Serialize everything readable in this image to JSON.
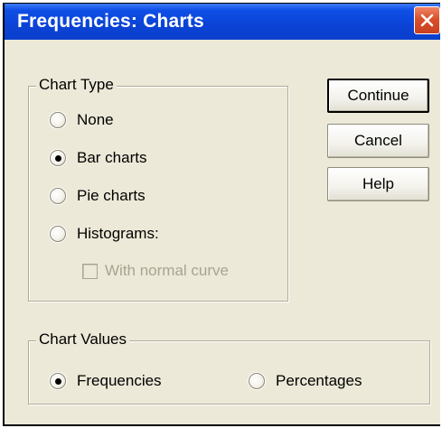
{
  "window": {
    "title": "Frequencies: Charts"
  },
  "chart_type": {
    "group_label": "Chart Type",
    "options": [
      {
        "label": "None",
        "selected": false
      },
      {
        "label": "Bar charts",
        "selected": true
      },
      {
        "label": "Pie charts",
        "selected": false
      },
      {
        "label": "Histograms:",
        "selected": false
      }
    ],
    "normal_curve": {
      "label": "With normal curve",
      "checked": false,
      "enabled": false
    }
  },
  "chart_values": {
    "group_label": "Chart Values",
    "options": [
      {
        "label": "Frequencies",
        "selected": true
      },
      {
        "label": "Percentages",
        "selected": false
      }
    ]
  },
  "buttons": {
    "continue": "Continue",
    "cancel": "Cancel",
    "help": "Help"
  },
  "colors": {
    "titlebar": "#0a44d4",
    "dialog_bg": "#ece9d8",
    "close_button": "#d9502a"
  }
}
